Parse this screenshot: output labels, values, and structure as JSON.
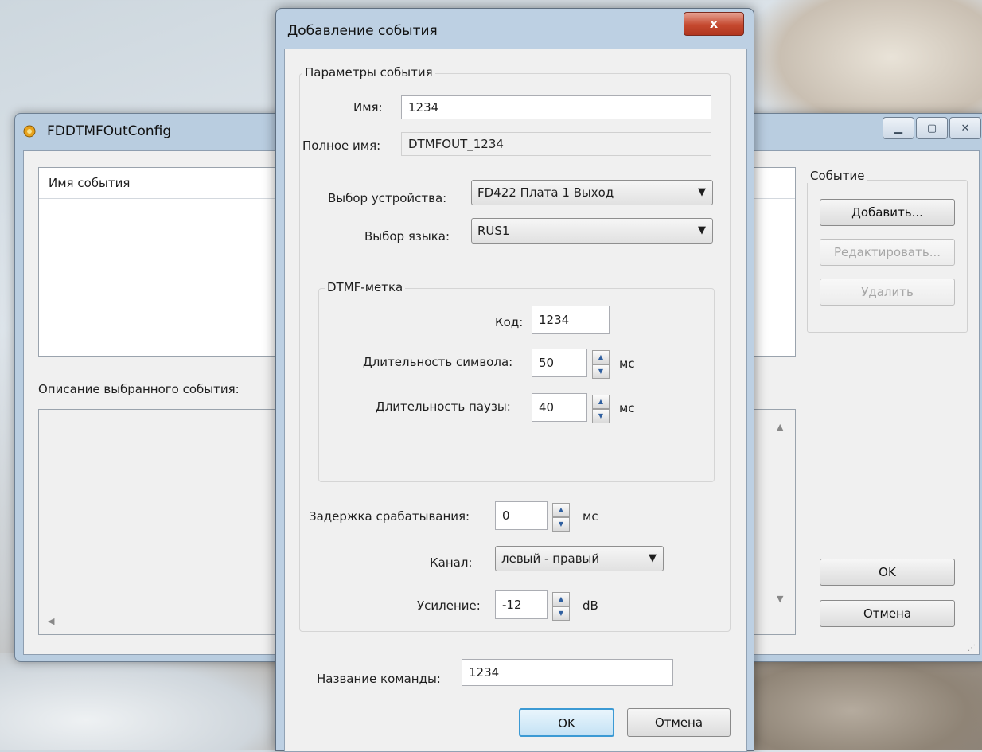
{
  "main_window": {
    "title": "FDDTMFOutConfig",
    "list_header": "Имя события",
    "description_label": "Описание выбранного события:",
    "event_group_title": "Событие",
    "buttons": {
      "add": "Добавить...",
      "edit": "Редактировать...",
      "delete": "Удалить",
      "ok": "OK",
      "cancel": "Отмена"
    }
  },
  "dialog": {
    "title": "Добавление события",
    "close_glyph": "x",
    "event_params_legend": "Параметры события",
    "name_label": "Имя:",
    "name_value": "1234",
    "fullname_label": "Полное имя:",
    "fullname_value": "DTMFOUT_1234",
    "device_label": "Выбор устройства:",
    "device_value": "FD422 Плата 1 Выход",
    "language_label": "Выбор языка:",
    "language_value": "RUS1",
    "dtmf_legend": "DTMF-метка",
    "code_label": "Код:",
    "code_value": "1234",
    "symbol_duration_label": "Длительность символа:",
    "symbol_duration_value": "50",
    "pause_duration_label": "Длительность паузы:",
    "pause_duration_value": "40",
    "ms_unit": "мс",
    "delay_label": "Задержка срабатывания:",
    "delay_value": "0",
    "channel_label": "Канал:",
    "channel_value": "левый - правый",
    "gain_label": "Усиление:",
    "gain_value": "-12",
    "gain_unit": "dB",
    "command_name_label": "Название команды:",
    "command_name_value": "1234",
    "ok": "OK",
    "cancel": "Отмена"
  }
}
